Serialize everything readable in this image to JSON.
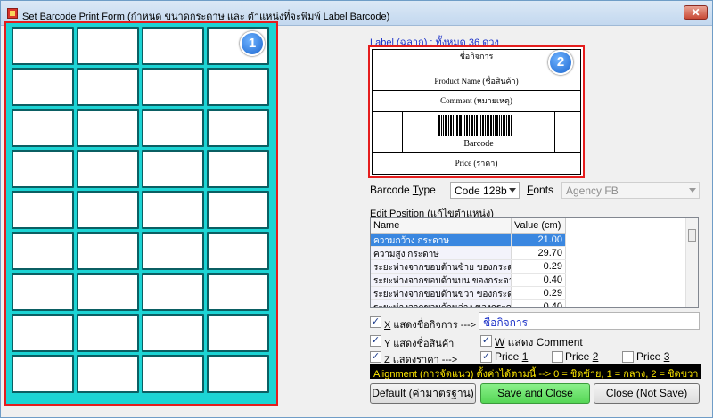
{
  "window": {
    "title": "Set Barcode Print Form (กำหนด ขนาดกระดาษ และ ตำแหน่งที่จะพิมพ์ Label Barcode)",
    "close_label": "✕"
  },
  "sheet": {
    "rows": 9,
    "cols": 4,
    "badge": "1"
  },
  "label": {
    "caption": "Label (ฉลาก) : ทั้งหมด 36 ดวง",
    "badge": "2",
    "company": "ชื่อกิจการ",
    "product": "Product Name (ชื่อสินค้า)",
    "comment": "Comment (หมายเหตุ)",
    "barcode": "Barcode",
    "price": "Price (ราคา)"
  },
  "barcode_type": {
    "label_pre": "Barcode ",
    "label_key": "T",
    "label_post": "ype",
    "value": "Code 128b"
  },
  "fonts": {
    "label_key": "F",
    "label_post": "onts",
    "value": "Agency FB"
  },
  "edit_position": {
    "label": "Edit Position (แก้ไขตำแหน่ง)",
    "columns": [
      "Name",
      "Value (cm)"
    ],
    "rows": [
      {
        "name": "ความกว้าง กระดาษ",
        "value": "21.00",
        "selected": true
      },
      {
        "name": "ความสูง กระดาษ",
        "value": "29.70"
      },
      {
        "name": "ระยะห่างจากขอบด้านซ้าย ของกระดาษ",
        "value": "0.29"
      },
      {
        "name": "ระยะห่างจากขอบด้านบน ของกระดาษ",
        "value": "0.40"
      },
      {
        "name": "ระยะห่างจากขอบด้านขวา ของกระดาษ",
        "value": "0.29"
      },
      {
        "name": "ระยะห่างจากขอบด้านล่าง ของกระดาษ",
        "value": "0.40"
      }
    ]
  },
  "options": {
    "x_key": "X",
    "x_label": " แสดงชื่อกิจการ --->",
    "x_value": "ชื่อกิจการ",
    "y_key": "Y",
    "y_label": " แสดงชื่อสินค้า",
    "w_key": "W",
    "w_label": " แสดง Comment",
    "z_key": "Z",
    "z_label": " แสดงราคา --->",
    "price1_pre": "Price ",
    "price1_key": "1",
    "price2_pre": "Price ",
    "price2_key": "2",
    "price3_pre": "Price ",
    "price3_key": "3"
  },
  "alignment": "Alignment (การจัดแนว) ตั้งค่าได้ตามนี้ --> 0 = ชิดซ้าย, 1 = กลาง, 2 = ชิดขวา",
  "buttons": {
    "default_key": "D",
    "default_rest": "efault (ค่ามาตรฐาน)",
    "save_key": "S",
    "save_rest": "ave and Close",
    "close_key": "C",
    "close_rest": "lose (Not Save)"
  },
  "colors": {
    "sheet_bg": "#1cd4d4",
    "highlight_border": "#e51d1d",
    "selection": "#3a87e0",
    "save_button": "#55d655"
  }
}
